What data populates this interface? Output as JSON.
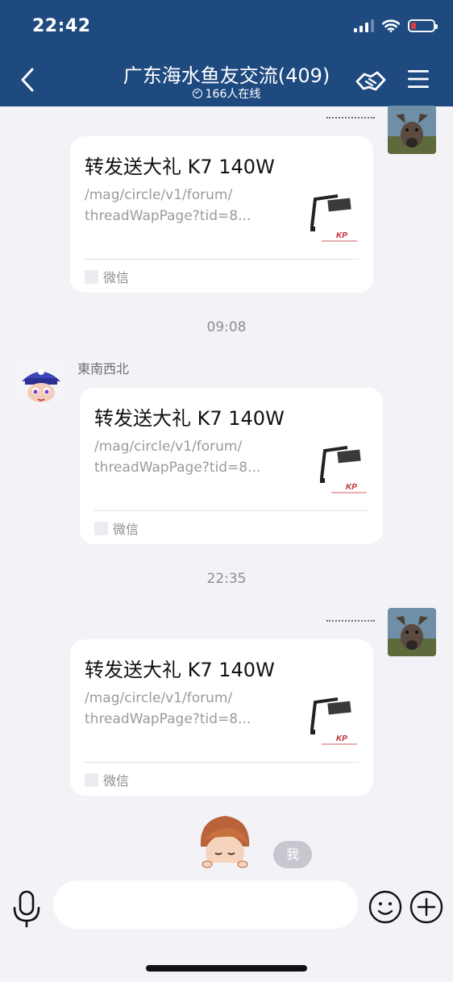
{
  "status_bar": {
    "time": "22:42",
    "battery_level": 0.2,
    "battery_color": "#e93d3d"
  },
  "header": {
    "title": "广东海水鱼友交流(409)",
    "online_count": "166人在线",
    "background": "#1e4a80",
    "icons": {
      "back": "chevron-left-icon",
      "handshake": "handshake-icon",
      "menu": "menu-icon"
    }
  },
  "messages": [
    {
      "type": "link-card",
      "direction": "outgoing",
      "title": "转发送大礼 K7 140W",
      "desc_line1": "/mag/circle/v1/forum/",
      "desc_line2": "threadWapPage?tid=8...",
      "source": "微信"
    },
    {
      "type": "time",
      "value": "09:08"
    },
    {
      "type": "link-card",
      "direction": "incoming",
      "sender": "東南西北",
      "title": "转发送大礼 K7 140W",
      "desc_line1": "/mag/circle/v1/forum/",
      "desc_line2": "threadWapPage?tid=8...",
      "source": "微信"
    },
    {
      "type": "time",
      "value": "22:35"
    },
    {
      "type": "link-card",
      "direction": "outgoing",
      "title": "转发送大礼 K7 140W",
      "desc_line1": "/mag/circle/v1/forum/",
      "desc_line2": "threadWapPage?tid=8...",
      "source": "微信"
    }
  ],
  "me_badge": "我",
  "input": {
    "placeholder": ""
  },
  "bottom_icons": {
    "voice": "microphone-icon",
    "emoji": "smiley-icon",
    "more": "plus-icon"
  }
}
